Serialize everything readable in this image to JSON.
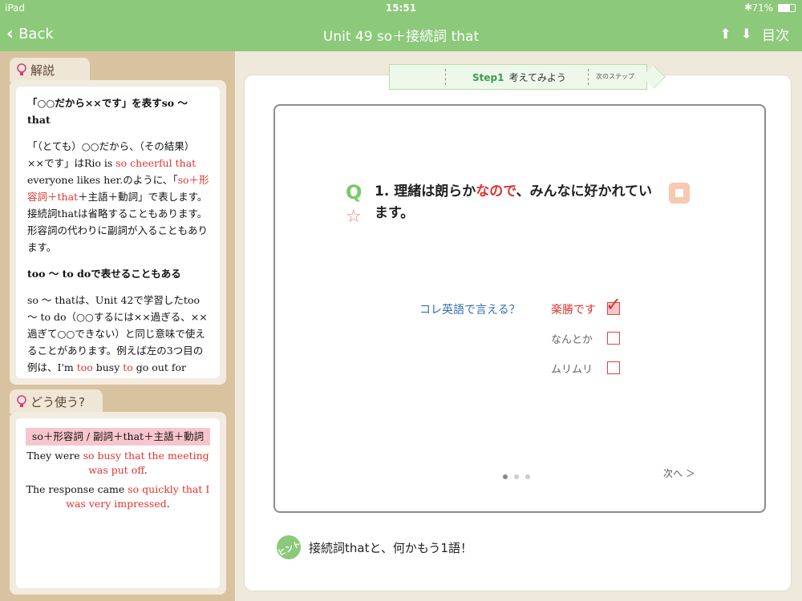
{
  "status": {
    "device": "iPad",
    "time": "15:51",
    "battery": "71%"
  },
  "nav": {
    "back_label": "Back",
    "title": "Unit 49 so＋接続詞 that",
    "toc_label": "目次"
  },
  "explanation": {
    "label": "解説",
    "heading1": "「○○だから××です」を表すso 〜 that",
    "p1_a": "「（とても）○○だから、（その結果）××です」はRio is ",
    "p1_red1": "so cheerful that",
    "p1_b": " everyone likes her.のように、「",
    "p1_red2": "so＋形容詞＋that",
    "p1_c": "＋主語＋動詞」で表します。接続詞thatは省略することもあります。形容詞の代わりに副詞が入ることもあります。",
    "heading2": "too 〜 to doで表せることもある",
    "p2_a": "so 〜 thatは、Unit 42で学習したtoo 〜 to do（○○するには××過ぎる、××過ぎて○○できない）と同じ意味で使えることがあります。例えば左の3つ目の例は、I'm ",
    "p2_red1": "too",
    "p2_b": " busy ",
    "p2_red2": "to",
    "p2_c": " go out for lunch.と言うこともできるのです。この意味で"
  },
  "usage": {
    "label": "どう使う?",
    "pattern": "so＋形容詞 / 副詞＋that＋主語＋動詞",
    "ex1_a": "They were ",
    "ex1_red": "so busy that the meeting was put off",
    "ex1_b": ".",
    "ex2_a": "The response came ",
    "ex2_red": "so quickly that I was very impressed",
    "ex2_b": "."
  },
  "step": {
    "current_num": "Step1",
    "current_label": "考えてみよう",
    "next_label": "次のステップ"
  },
  "question": {
    "q_mark": "Q",
    "text_a": "1. 理緒は朗らか",
    "text_red": "なので",
    "text_b": "、みんなに好かれています。",
    "prompt": "コレ英語で言える？",
    "options": [
      {
        "label": "楽勝です",
        "selected": true
      },
      {
        "label": "なんとか",
        "selected": false
      },
      {
        "label": "ムリムリ",
        "selected": false
      }
    ],
    "next_label": "次へ ＞"
  },
  "hint": {
    "icon_text": "ヒント",
    "text": "接続詞thatと、何かもう1語！"
  },
  "colors": {
    "accent": "#8cc97a",
    "red": "#e0322f",
    "blue": "#2f6fb2"
  }
}
